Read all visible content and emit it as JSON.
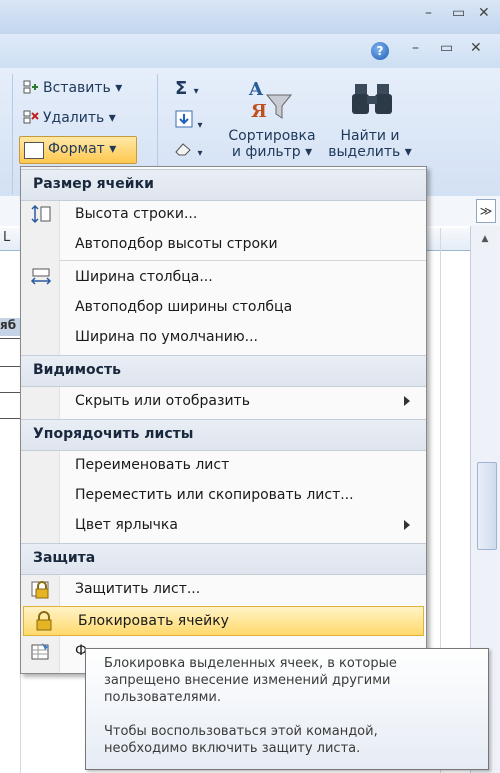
{
  "window": {
    "controls": [
      "–",
      "▭",
      "✕"
    ]
  },
  "ribbon": {
    "help_glyph": "?",
    "cells_group": {
      "insert_label": "Вставить",
      "delete_label": "Удалить",
      "format_label": "Формат"
    },
    "editing_group": {
      "sum_glyph": "Σ",
      "sort_filter_label_1": "Сортировка",
      "sort_filter_label_2": "и фильтр",
      "find_select_label_1": "Найти и",
      "find_select_label_2": "выделить"
    }
  },
  "sheet": {
    "column_label": "L",
    "partial_cell_text": "яб"
  },
  "menu": {
    "sections": {
      "cell_size": "Размер ячейки",
      "visibility": "Видимость",
      "organize_sheets": "Упорядочить листы",
      "protection": "Защита"
    },
    "items": {
      "row_height": "Высота строки...",
      "autofit_row": "Автоподбор высоты строки",
      "column_width": "Ширина столбца...",
      "autofit_column": "Автоподбор ширины столбца",
      "default_width": "Ширина по умолчанию...",
      "hide_unhide": "Скрыть или отобразить",
      "rename_sheet": "Переименовать лист",
      "move_copy_sheet": "Переместить или скопировать лист...",
      "tab_color": "Цвет ярлычка",
      "protect_sheet": "Защитить лист...",
      "lock_cell": "Блокировать ячейку",
      "format_cells_partial": "Ф"
    }
  },
  "tooltip": {
    "line1": "Блокировка выделенных ячеек, в которые",
    "line2": "запрещено внесение изменений другими",
    "line3": "пользователями.",
    "line4": "Чтобы воспользоваться этой командой,",
    "line5": "необходимо включить защиту листа."
  },
  "colors": {
    "highlight": "#ffd96b",
    "ribbon": "#d3e1f4",
    "section_header": "#e2e8f0"
  }
}
